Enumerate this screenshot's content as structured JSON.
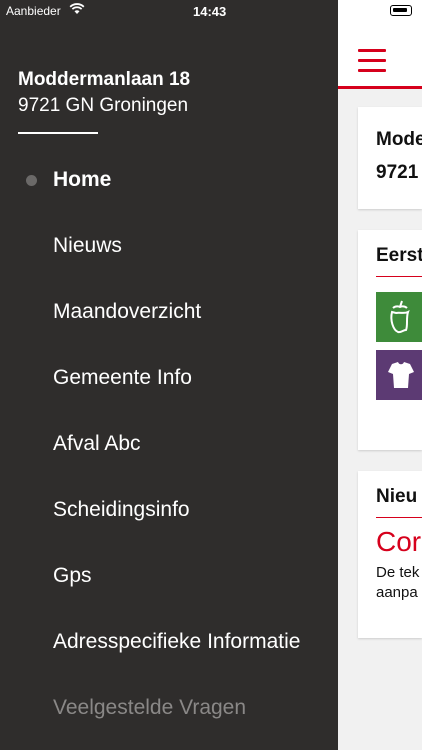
{
  "status_bar": {
    "carrier": "Aanbieder",
    "time": "14:43"
  },
  "drawer": {
    "address_line1": "Moddermanlaan 18",
    "address_line2": "9721 GN Groningen",
    "menu": [
      {
        "label": "Home"
      },
      {
        "label": "Nieuws"
      },
      {
        "label": "Maandoverzicht"
      },
      {
        "label": "Gemeente Info"
      },
      {
        "label": "Afval Abc"
      },
      {
        "label": "Scheidingsinfo"
      },
      {
        "label": "Gps"
      },
      {
        "label": "Adresspecifieke Informatie"
      },
      {
        "label": "Veelgestelde Vragen"
      }
    ]
  },
  "content": {
    "address_card": {
      "line1": "Mode",
      "line2": "9721"
    },
    "first_card": {
      "title": "Eerst"
    },
    "news_card": {
      "title": "Nieu",
      "headline": "Cor",
      "body_line1": "De tek",
      "body_line2": "aanpa"
    }
  },
  "colors": {
    "accent": "#d6001c",
    "drawer_bg": "#2f2d2c",
    "green_tile": "#3e8b3a",
    "purple_tile": "#5c3a73"
  },
  "icons": [
    "wifi-icon",
    "battery-icon",
    "hamburger-menu-icon",
    "organic-waste-icon",
    "textile-icon"
  ]
}
